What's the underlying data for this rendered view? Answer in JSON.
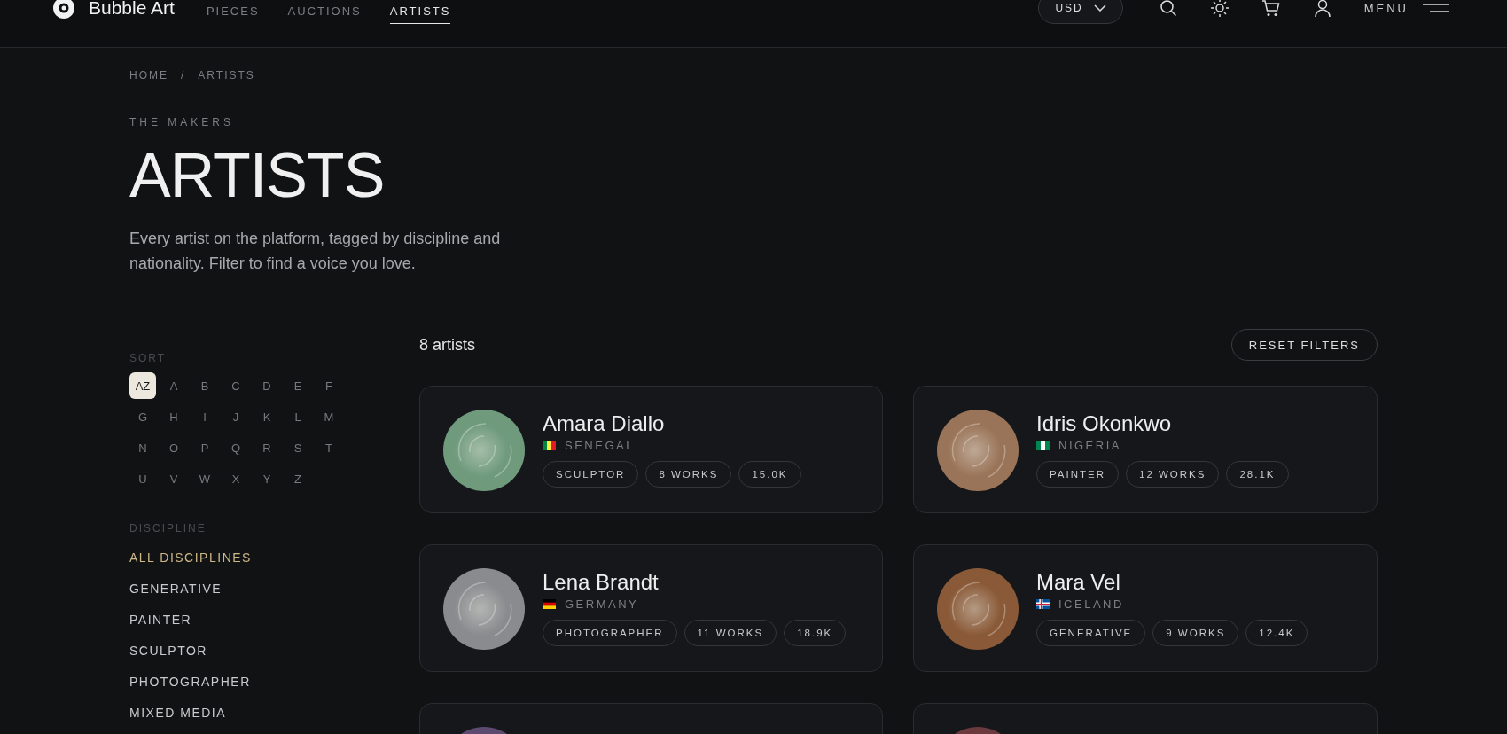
{
  "header": {
    "brand": "Bubble Art",
    "nav": [
      {
        "label": "PIECES",
        "selected": false
      },
      {
        "label": "AUCTIONS",
        "selected": false
      },
      {
        "label": "ARTISTS",
        "selected": true
      }
    ],
    "currency": "USD",
    "menu_label": "MENU"
  },
  "breadcrumb": [
    "HOME",
    "/",
    "ARTISTS"
  ],
  "eyebrow": "THE MAKERS",
  "title": "ARTISTS",
  "intro": "Every artist on the platform, tagged by discipline and nationality. Filter to find a voice you love.",
  "sidebar": {
    "sort_label": "SORT",
    "letters": [
      {
        "label": "AZ",
        "selected": true
      },
      {
        "label": "A",
        "selected": false
      },
      {
        "label": "B",
        "selected": false
      },
      {
        "label": "C",
        "selected": false
      },
      {
        "label": "D",
        "selected": false
      },
      {
        "label": "E",
        "selected": false
      },
      {
        "label": "F",
        "selected": false
      },
      {
        "label": "G",
        "selected": false
      },
      {
        "label": "H",
        "selected": false
      },
      {
        "label": "I",
        "selected": false
      },
      {
        "label": "J",
        "selected": false
      },
      {
        "label": "K",
        "selected": false
      },
      {
        "label": "L",
        "selected": false
      },
      {
        "label": "M",
        "selected": false
      },
      {
        "label": "N",
        "selected": false
      },
      {
        "label": "O",
        "selected": false
      },
      {
        "label": "P",
        "selected": false
      },
      {
        "label": "Q",
        "selected": false
      },
      {
        "label": "R",
        "selected": false
      },
      {
        "label": "S",
        "selected": false
      },
      {
        "label": "T",
        "selected": false
      },
      {
        "label": "U",
        "selected": false
      },
      {
        "label": "V",
        "selected": false
      },
      {
        "label": "W",
        "selected": false
      },
      {
        "label": "X",
        "selected": false
      },
      {
        "label": "Y",
        "selected": false
      },
      {
        "label": "Z",
        "selected": false
      }
    ],
    "discipline_label": "DISCIPLINE",
    "disciplines": [
      {
        "label": "ALL DISCIPLINES",
        "selected": true
      },
      {
        "label": "GENERATIVE",
        "selected": false
      },
      {
        "label": "PAINTER",
        "selected": false
      },
      {
        "label": "SCULPTOR",
        "selected": false
      },
      {
        "label": "PHOTOGRAPHER",
        "selected": false
      },
      {
        "label": "MIXED MEDIA",
        "selected": false
      }
    ]
  },
  "results": {
    "count": "8 artists",
    "reset_button": "RESET FILTERS"
  },
  "artists": [
    {
      "name": "Amara Diallo",
      "country": "SENEGAL",
      "color": "#6f9a7c",
      "flag": {
        "kind": "vertical",
        "stripes": [
          {
            "color": "#00853f"
          },
          {
            "color": "#fdef42"
          },
          {
            "color": "#e31b23"
          }
        ]
      },
      "tags": [
        "SCULPTOR",
        "8 WORKS",
        "15.0K"
      ]
    },
    {
      "name": "Idris Okonkwo",
      "country": "NIGERIA",
      "color": "#9a7458",
      "flag": {
        "kind": "vertical",
        "stripes": [
          {
            "color": "#008751"
          },
          {
            "color": "#ffffff"
          },
          {
            "color": "#008751"
          }
        ]
      },
      "tags": [
        "PAINTER",
        "12 WORKS",
        "28.1K"
      ]
    },
    {
      "name": "Lena Brandt",
      "country": "GERMANY",
      "color": "#8a8b8e",
      "flag": {
        "kind": "horizontal",
        "stripes": [
          {
            "color": "#000000"
          },
          {
            "color": "#dd0000"
          },
          {
            "color": "#ffce00"
          }
        ]
      },
      "tags": [
        "PHOTOGRAPHER",
        "11 WORKS",
        "18.9K"
      ]
    },
    {
      "name": "Mara Vel",
      "country": "ICELAND",
      "color": "#8a5a38",
      "flag": {
        "kind": "nordic",
        "stripes": [
          {
            "color": "#02529c"
          },
          {
            "color": "#ffffff"
          },
          {
            "color": "#dc1e35"
          }
        ]
      },
      "tags": [
        "GENERATIVE",
        "9 WORKS",
        "12.4K"
      ]
    },
    {
      "color": "#5c4a70"
    },
    {
      "color": "#6a3a3e"
    }
  ]
}
